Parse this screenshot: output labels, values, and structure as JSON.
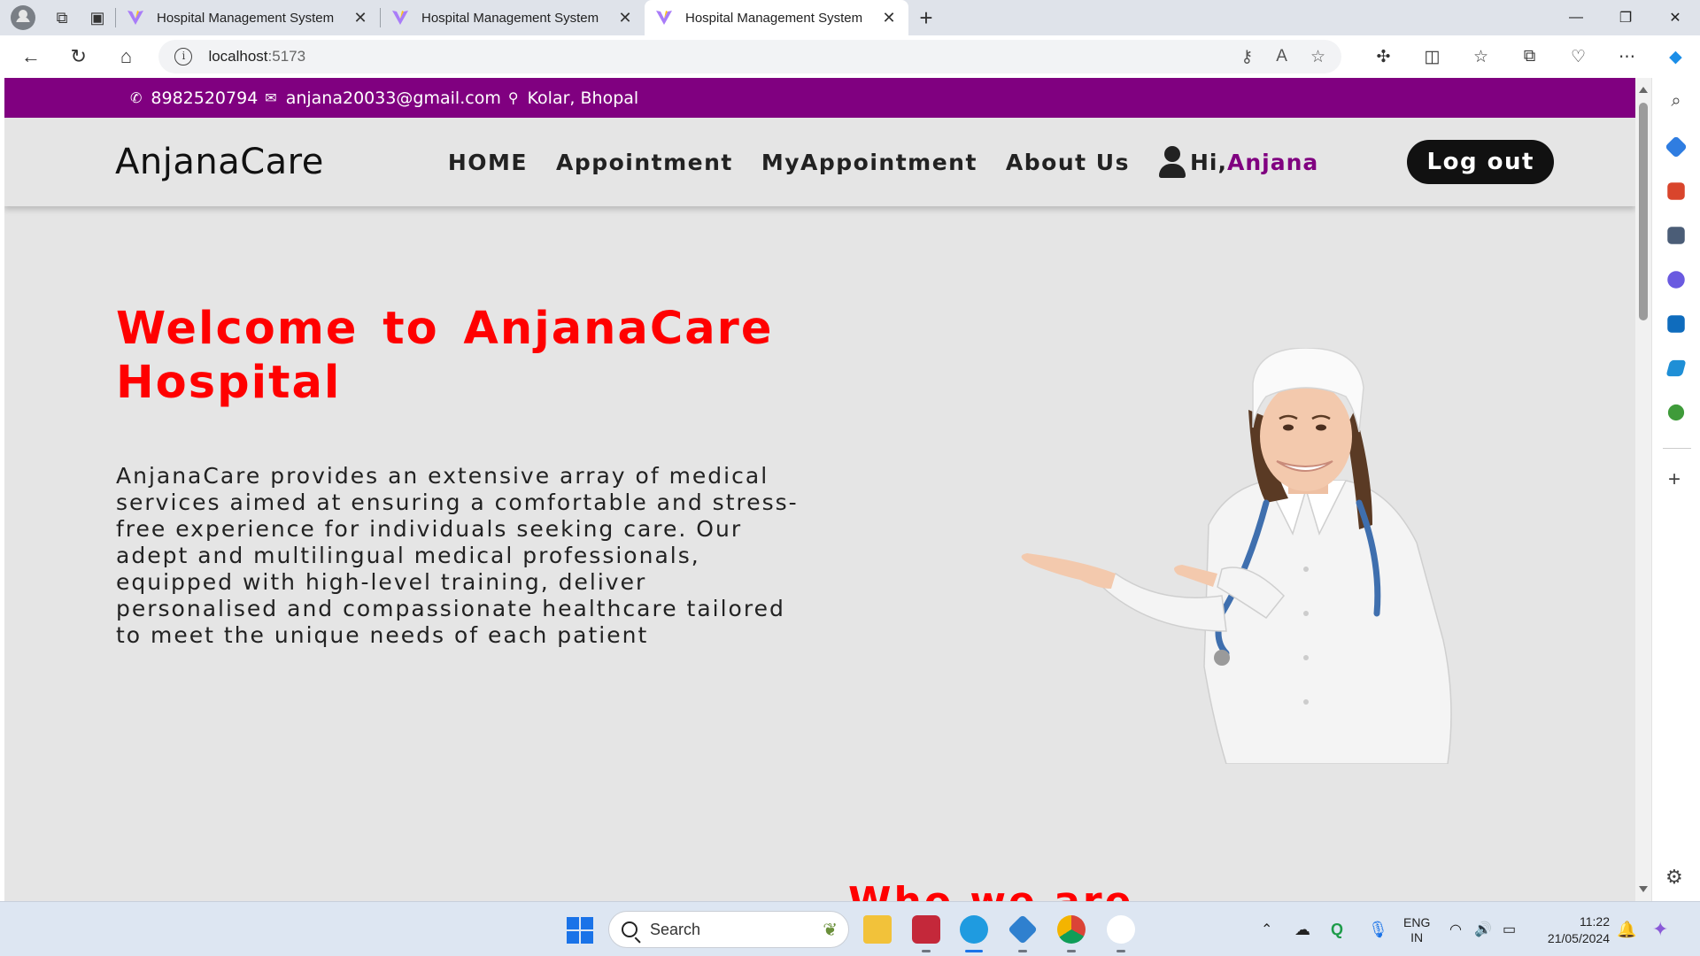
{
  "browser": {
    "tabs": [
      {
        "title": "Hospital Management System",
        "active": false
      },
      {
        "title": "Hospital Management System",
        "active": false
      },
      {
        "title": "Hospital Management System",
        "active": true
      }
    ],
    "url_host": "localhost",
    "url_port": ":5173",
    "window_controls": {
      "minimize": "—",
      "restore": "❐",
      "close": "✕"
    }
  },
  "site": {
    "topbar": {
      "phone": "8982520794",
      "email": "anjana20033@gmail.com",
      "location": "Kolar, Bhopal"
    },
    "brand": "AnjanaCare",
    "menu": [
      {
        "label": "HOME"
      },
      {
        "label": "Appointment"
      },
      {
        "label": "MyAppointment"
      },
      {
        "label": "About Us"
      }
    ],
    "greeting_prefix": "Hi,",
    "user_name": "Anjana",
    "logout_label": "Log out",
    "hero": {
      "title": "Welcome to AnjanaCare Hospital",
      "description": "AnjanaCare provides an extensive array of medical services aimed at ensuring a comfortable and stress-free experience for individuals seeking care. Our adept and multilingual medical professionals, equipped with high-level training, deliver personalised and compassionate healthcare tailored to meet the unique needs of each patient"
    },
    "next_section_title": "Who we are"
  },
  "taskbar": {
    "search_placeholder": "Search",
    "lang_line1": "ENG",
    "lang_line2": "IN",
    "time": "11:22",
    "date": "21/05/2024"
  },
  "colors": {
    "topbar": "#800080",
    "accent_red": "#ff0000",
    "username": "#800080",
    "logout_bg": "#111111",
    "page_bg": "#e5e5e5"
  }
}
